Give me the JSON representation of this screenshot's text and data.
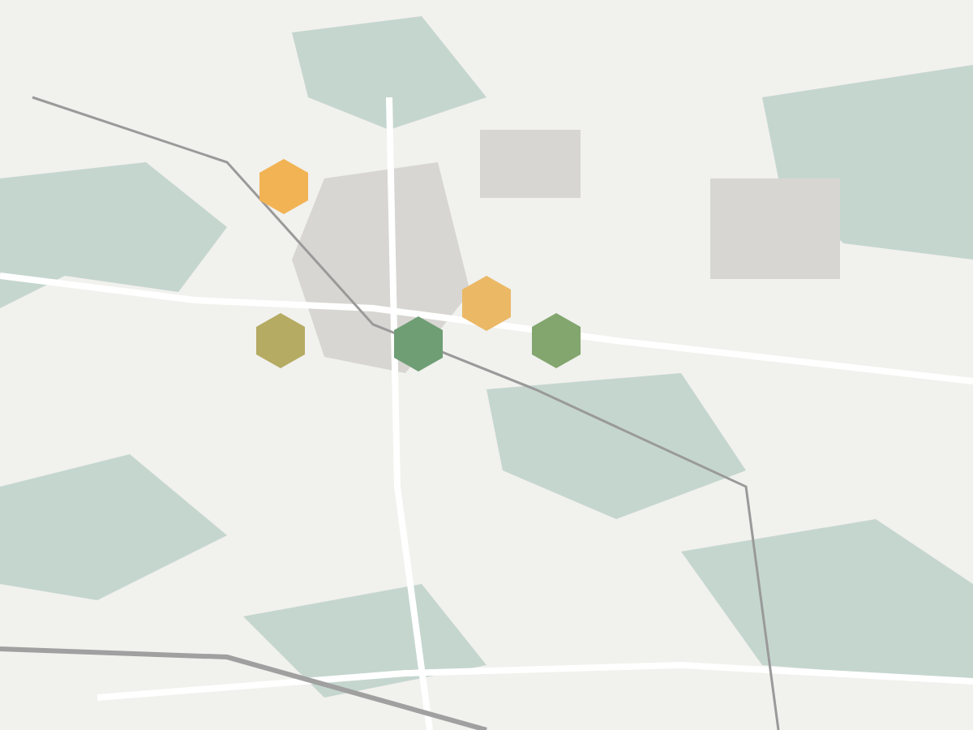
{
  "map": {
    "markers": [
      {
        "color": "#f2b354"
      },
      {
        "color": "#b5ab62"
      },
      {
        "color": "#6f9e74"
      },
      {
        "color": "#ebb865"
      },
      {
        "color": "#82a66e"
      }
    ]
  }
}
